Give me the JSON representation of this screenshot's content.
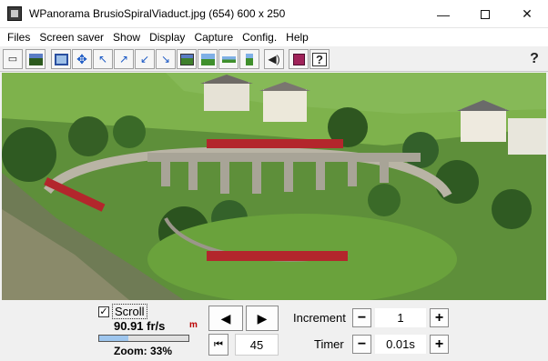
{
  "window": {
    "title": "WPanorama  BrusioSpiralViaduct.jpg   (654) 600 x 250",
    "minimize_glyph": "—",
    "close_glyph": "✕"
  },
  "menu": [
    "Files",
    "Screen saver",
    "Show",
    "Display",
    "Capture",
    "Config.",
    "Help"
  ],
  "toolbar": {
    "buttons": [
      {
        "name": "open-file-icon",
        "glyph": "📂"
      },
      {
        "name": "show-image-icon",
        "glyph": "🖼"
      },
      {
        "name": "fit-window-icon",
        "glyph": "▣"
      },
      {
        "name": "move-all-directions-icon",
        "glyph": "✥"
      },
      {
        "name": "arrow-upleft-icon",
        "glyph": "↖"
      },
      {
        "name": "arrow-upright-icon",
        "glyph": "↗"
      },
      {
        "name": "arrow-downleft-icon",
        "glyph": "↙"
      },
      {
        "name": "arrow-downright-icon",
        "glyph": "↘"
      },
      {
        "name": "panorama-view-icon",
        "glyph": "▤"
      },
      {
        "name": "landscape-view-icon",
        "glyph": "▨"
      },
      {
        "name": "flat-view-icon",
        "glyph": "▬"
      },
      {
        "name": "vertical-view-icon",
        "glyph": "▥"
      },
      {
        "name": "sound-icon",
        "glyph": "🔊"
      },
      {
        "name": "book-icon",
        "glyph": "📕"
      },
      {
        "name": "help-topics-icon",
        "glyph": "?"
      },
      {
        "name": "help-question-icon",
        "glyph": "?"
      }
    ]
  },
  "controls": {
    "scroll_checkbox": "✓",
    "scroll_label": "Scroll",
    "fps": "90.91 fr/s",
    "fps_icon": "m",
    "zoom_level": 0.33,
    "zoom_text": "Zoom: 33%",
    "prev_glyph": "◀",
    "next_glyph": "▶",
    "first_glyph": "⏮",
    "frame_value": "45",
    "increment_label": "Increment",
    "increment_value": "1",
    "timer_label": "Timer",
    "timer_value": "0.01s",
    "minus_glyph": "−",
    "plus_glyph": "+"
  },
  "colors": {
    "train_red": "#b3262c",
    "grass_green": "#6aa23c",
    "viaduct_stone": "#a8a497"
  }
}
